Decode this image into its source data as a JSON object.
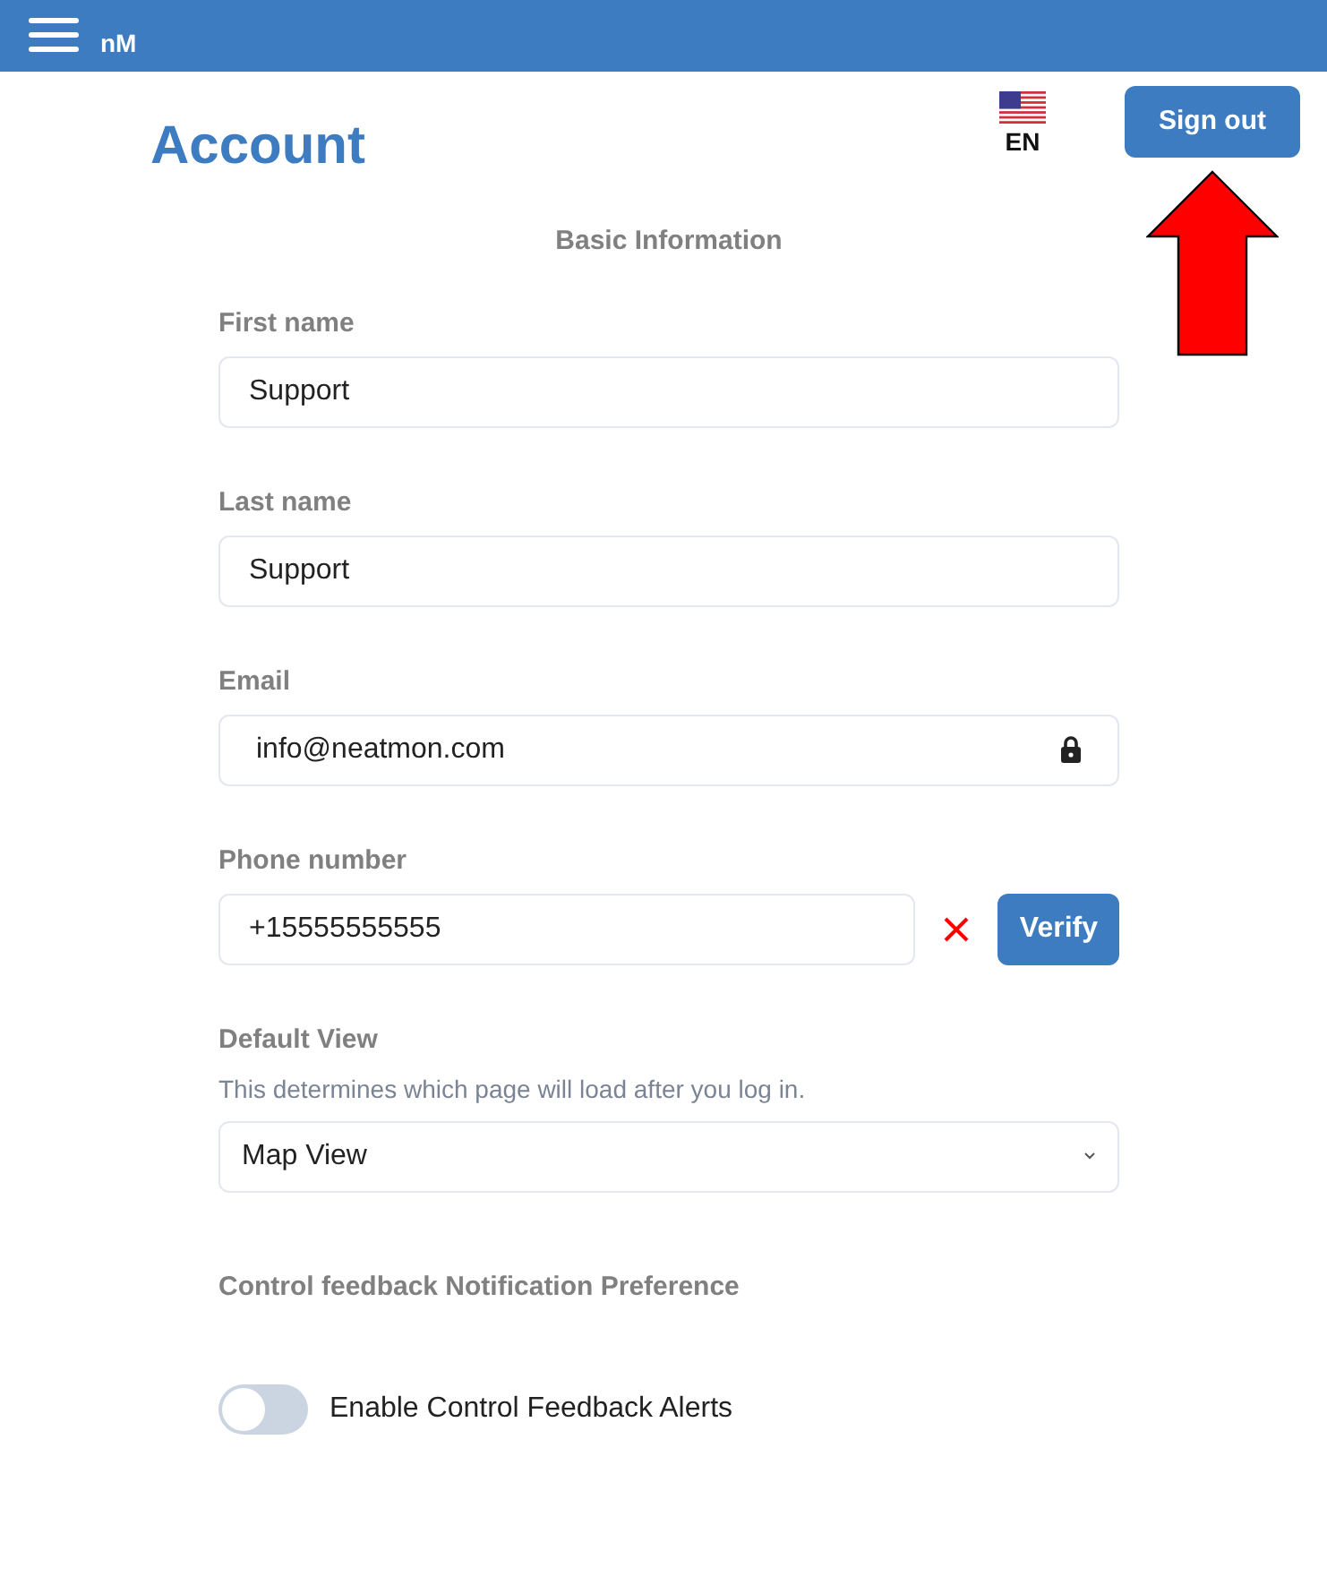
{
  "header": {
    "logo": "nM"
  },
  "page": {
    "title": "Account",
    "language": "EN",
    "sign_out": "Sign out"
  },
  "section_title": "Basic Information",
  "fields": [
    {
      "kind": "text",
      "label": "First name",
      "value": "Support"
    },
    {
      "kind": "text",
      "label": "Last name",
      "value": "Support"
    },
    {
      "kind": "locked",
      "label": "Email",
      "value": "info@neatmon.com"
    },
    {
      "kind": "phone",
      "label": "Phone number",
      "value": "+15555555555",
      "verified": false,
      "button": "Verify"
    },
    {
      "kind": "select",
      "label": "Default View",
      "help": "This determines which page will load after you log in.",
      "value": "Map View"
    }
  ],
  "notification": {
    "title": "Control feedback Notification Preference",
    "toggle_label": "Enable Control Feedback Alerts",
    "on": false
  }
}
